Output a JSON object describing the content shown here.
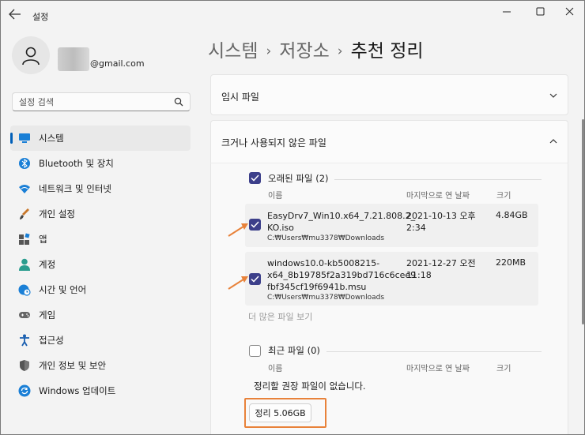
{
  "window": {
    "title": "설정"
  },
  "profile": {
    "email_suffix": "@gmail.com"
  },
  "search": {
    "placeholder": "설정 검색"
  },
  "sidebar": {
    "items": [
      {
        "label": "시스템",
        "icon": "system-icon",
        "active": true
      },
      {
        "label": "Bluetooth 및 장치",
        "icon": "bluetooth-icon"
      },
      {
        "label": "네트워크 및 인터넷",
        "icon": "wifi-icon"
      },
      {
        "label": "개인 설정",
        "icon": "brush-icon"
      },
      {
        "label": "앱",
        "icon": "apps-icon"
      },
      {
        "label": "계정",
        "icon": "account-icon"
      },
      {
        "label": "시간 및 언어",
        "icon": "clock-globe-icon"
      },
      {
        "label": "게임",
        "icon": "gamepad-icon"
      },
      {
        "label": "접근성",
        "icon": "accessibility-icon"
      },
      {
        "label": "개인 정보 및 보안",
        "icon": "shield-icon"
      },
      {
        "label": "Windows 업데이트",
        "icon": "update-icon"
      }
    ]
  },
  "breadcrumb": {
    "level1": "시스템",
    "level2": "저장소",
    "current": "추천 정리",
    "separator": "›"
  },
  "sections": {
    "temp_files": {
      "title": "임시 파일"
    },
    "large_unused": {
      "title": "크거나 사용되지 않은 파일"
    }
  },
  "old_files": {
    "label": "오래된 파일 (2)",
    "checked": true,
    "columns": {
      "name": "이름",
      "modified": "마지막으로 연 날짜",
      "size": "크기"
    },
    "files": [
      {
        "name_line1": "EasyDrv7_Win10.x64_7.21.808.2_",
        "name_line2": "KO.iso",
        "path": "C:₩Users₩mu3378₩Downloads",
        "date_line1": "2021-10-13 오후",
        "date_line2": "2:34",
        "size": "4.84GB",
        "checked": true
      },
      {
        "name_line1": "windows10.0-kb5008215-",
        "name_line2": "x64_8b19785f2a319bd716c6cee9",
        "name_line3": "fbf345cf19f6941b.msu",
        "path": "C:₩Users₩mu3378₩Downloads",
        "date_line1": "2021-12-27 오전",
        "date_line2": "11:18",
        "size": "220MB",
        "checked": true
      }
    ],
    "more_link": "더 많은 파일 보기"
  },
  "recent_files": {
    "label": "최근 파일 (0)",
    "checked": false,
    "columns": {
      "name": "이름",
      "modified": "마지막으로 연 날짜",
      "size": "크기"
    },
    "empty_message": "정리할 권장 파일이 없습니다."
  },
  "clean_button": {
    "label": "정리 5.06GB"
  },
  "colors": {
    "accent": "#005fb8",
    "checkbox": "#3c3f8a",
    "annotation": "#e8823a"
  }
}
